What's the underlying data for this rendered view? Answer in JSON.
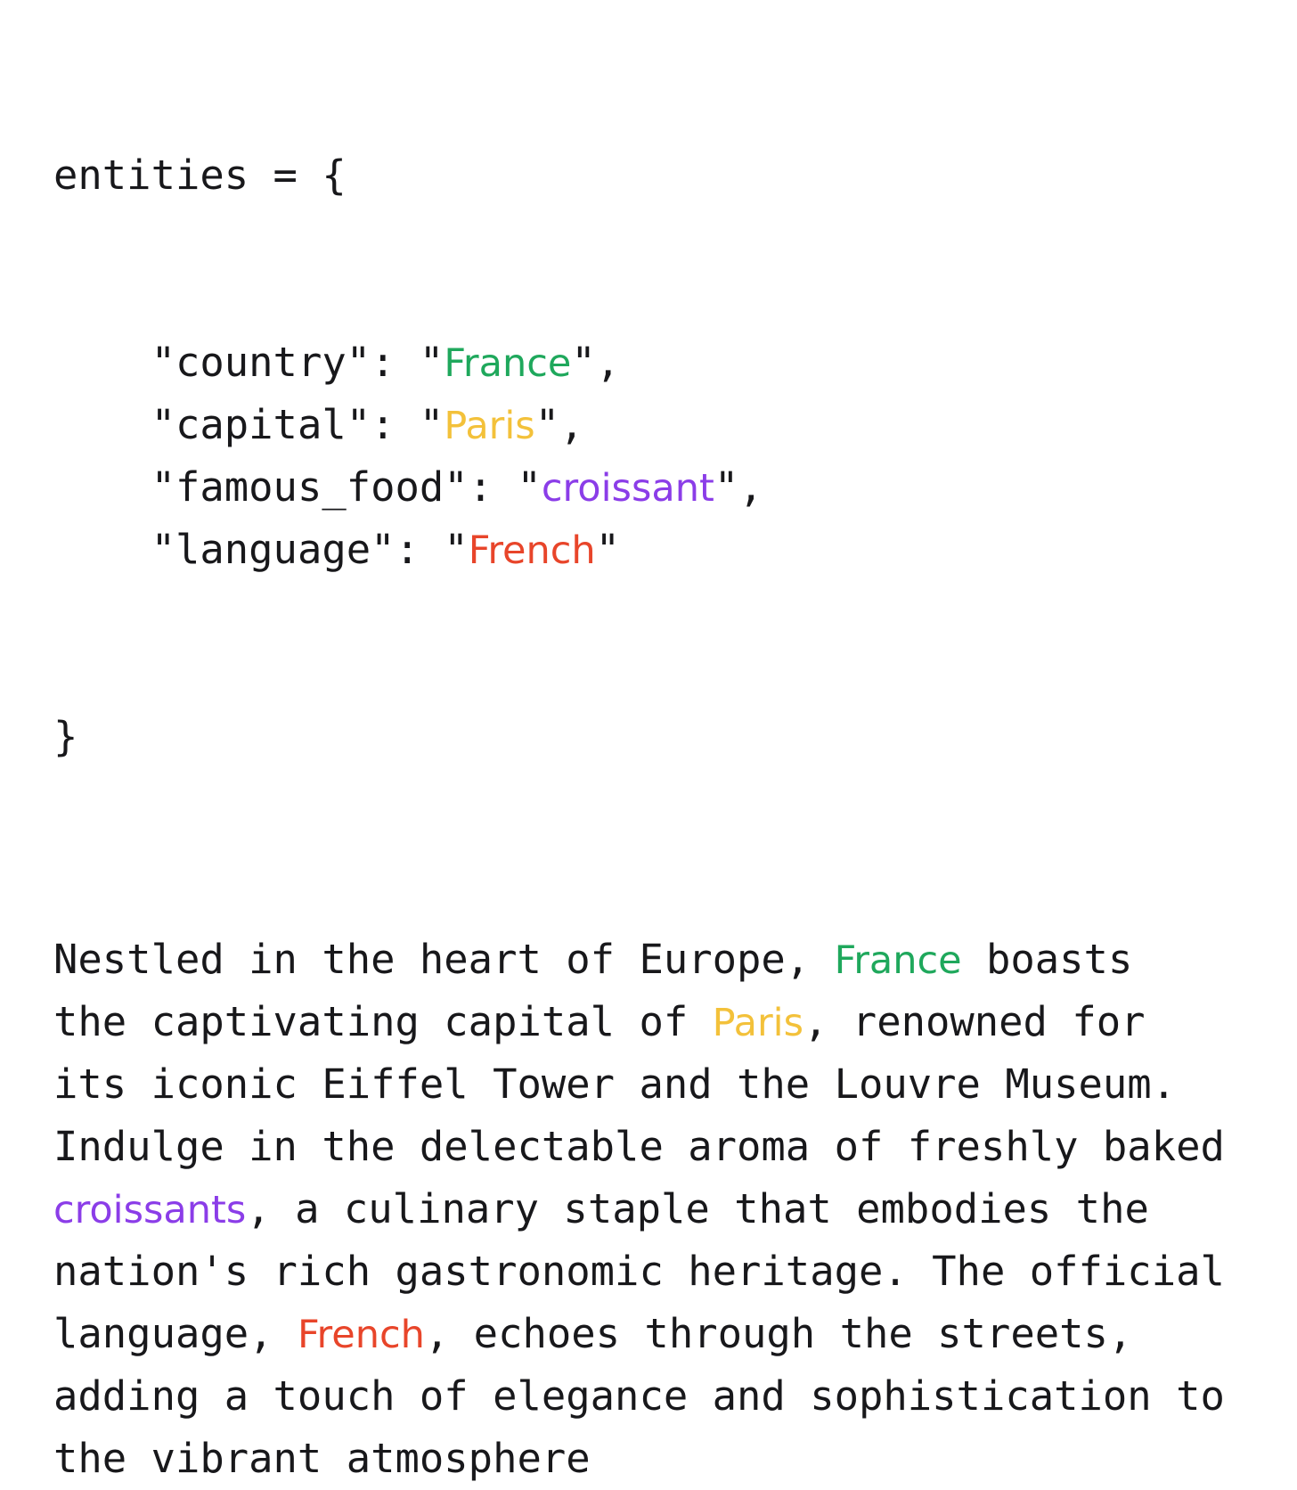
{
  "palette": {
    "background": "#ffffff",
    "text": "#18181b",
    "country_green": "#1fa85c",
    "capital_yellow": "#f3c13a",
    "food_purple": "#8b3de8",
    "language_red": "#e8452a"
  },
  "code_block": {
    "header": "entities = {",
    "closer": "}",
    "entries": [
      {
        "indent": "    ",
        "key_quoted": "\"country\"",
        "colon_space": ": ",
        "open_quote": "\"",
        "value": "France",
        "close_quote": "\"",
        "trailing": ",",
        "color_role": "country_green"
      },
      {
        "indent": "    ",
        "key_quoted": "\"capital\"",
        "colon_space": ": ",
        "open_quote": "\"",
        "value": "Paris",
        "close_quote": "\"",
        "trailing": ",",
        "color_role": "capital_yellow"
      },
      {
        "indent": "    ",
        "key_quoted": "\"famous_food\"",
        "colon_space": ": ",
        "open_quote": "\"",
        "value": "croissant",
        "close_quote": "\"",
        "trailing": ",",
        "color_role": "food_purple"
      },
      {
        "indent": "    ",
        "key_quoted": "\"language\"",
        "colon_space": ": ",
        "open_quote": "\"",
        "value": "French",
        "close_quote": "\"",
        "trailing": "",
        "color_role": "language_red"
      }
    ]
  },
  "prose": {
    "full_text": "Nestled in the heart of Europe, France boasts the captivating capital of Paris, renowned for its iconic Eiffel Tower and the Louvre Museum. Indulge in the delectable aroma of freshly baked croissants, a culinary staple that embodies the nation's rich gastronomic heritage. The official language, French, echoes through the streets, adding a touch of elegance and sophistication to the vibrant atmosphere",
    "lines": [
      {
        "segments": [
          {
            "text": "Nestled in the heart of Europe, ",
            "color_role": "text"
          },
          {
            "text": "France",
            "color_role": "country_green"
          },
          {
            "text": " boasts",
            "color_role": "text"
          }
        ]
      },
      {
        "segments": [
          {
            "text": "the captivating capital of ",
            "color_role": "text"
          },
          {
            "text": "Paris",
            "color_role": "capital_yellow"
          },
          {
            "text": ", renowned for",
            "color_role": "text"
          }
        ]
      },
      {
        "segments": [
          {
            "text": "its iconic Eiffel Tower and the Louvre Museum.",
            "color_role": "text"
          }
        ]
      },
      {
        "segments": [
          {
            "text": "Indulge in the delectable aroma of freshly baked",
            "color_role": "text"
          }
        ]
      },
      {
        "segments": [
          {
            "text": "croissants",
            "color_role": "food_purple"
          },
          {
            "text": ", a culinary staple that embodies the",
            "color_role": "text"
          }
        ]
      },
      {
        "segments": [
          {
            "text": "nation's rich gastronomic heritage. The official",
            "color_role": "text"
          }
        ]
      },
      {
        "segments": [
          {
            "text": "language, ",
            "color_role": "text"
          },
          {
            "text": "French",
            "color_role": "language_red"
          },
          {
            "text": ", echoes through the streets,",
            "color_role": "text"
          }
        ]
      },
      {
        "segments": [
          {
            "text": "adding a touch of elegance and sophistication to",
            "color_role": "text"
          }
        ]
      },
      {
        "segments": [
          {
            "text": "the vibrant atmosphere",
            "color_role": "text"
          }
        ]
      }
    ]
  }
}
